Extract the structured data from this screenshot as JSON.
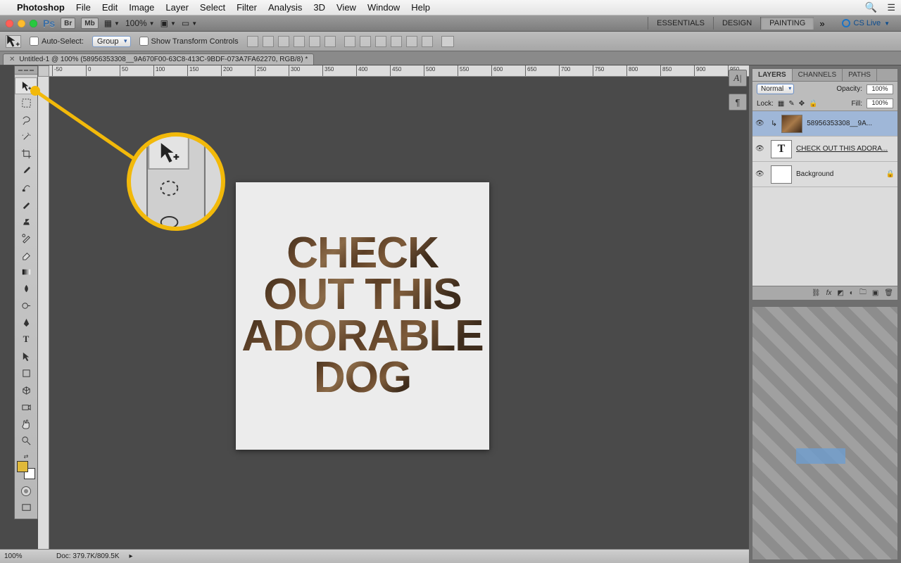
{
  "menubar": {
    "app": "Photoshop",
    "items": [
      "File",
      "Edit",
      "Image",
      "Layer",
      "Select",
      "Filter",
      "Analysis",
      "3D",
      "View",
      "Window",
      "Help"
    ]
  },
  "chrome": {
    "br": "Br",
    "mb": "Mb",
    "zoom": "100%",
    "cslive": "CS Live"
  },
  "workspaces": {
    "items": [
      "ESSENTIALS",
      "DESIGN",
      "PAINTING"
    ],
    "active": "PAINTING"
  },
  "options": {
    "auto_select_label": "Auto-Select:",
    "auto_select_value": "Group",
    "show_transform": "Show Transform Controls"
  },
  "doc_tab": {
    "title": "Untitled-1 @ 100% (58956353308__9A670F00-63C8-413C-9BDF-073A7FA62270, RGB/8) *"
  },
  "canvas_text": {
    "line1": "CHECK",
    "line2": "OUT THIS",
    "line3": "ADORABLE",
    "line4": "DOG"
  },
  "layers_panel": {
    "tabs": [
      "LAYERS",
      "CHANNELS",
      "PATHS"
    ],
    "active": "LAYERS",
    "blend_mode": "Normal",
    "opacity_label": "Opacity:",
    "opacity_value": "100%",
    "lock_label": "Lock:",
    "fill_label": "Fill:",
    "fill_value": "100%",
    "layers": [
      {
        "name": "58956353308__9A...",
        "kind": "image",
        "selected": true,
        "clip": true
      },
      {
        "name": "CHECK OUT THIS ADORA...",
        "kind": "text",
        "selected": false,
        "clip": false
      },
      {
        "name": "Background",
        "kind": "bg",
        "selected": false,
        "locked": true
      }
    ]
  },
  "status": {
    "zoom": "100%",
    "doc": "Doc: 379.7K/809.5K"
  },
  "ruler_marks": [
    -50,
    0,
    50,
    100,
    150,
    200,
    250,
    300,
    350,
    400,
    450,
    500,
    550,
    600,
    650,
    700,
    750,
    800,
    850,
    900,
    950
  ]
}
